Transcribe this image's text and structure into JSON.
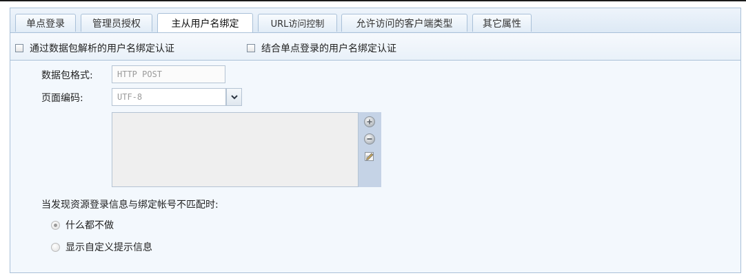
{
  "tabs": [
    {
      "label": "单点登录"
    },
    {
      "label": "管理员授权"
    },
    {
      "label": "主从用户名绑定"
    },
    {
      "label": "URL访问控制"
    },
    {
      "label": "允许访问的客户端类型"
    },
    {
      "label": "其它属性"
    }
  ],
  "active_tab": "主从用户名绑定",
  "options": {
    "packet_parse_binding": {
      "label": "通过数据包解析的用户名绑定认证",
      "checked": false
    },
    "sso_binding": {
      "label": "结合单点登录的用户名绑定认证",
      "checked": false
    }
  },
  "form": {
    "packet_format": {
      "label": "数据包格式:",
      "value": "HTTP POST"
    },
    "page_encoding": {
      "label": "页面编码:",
      "value": "UTF-8"
    },
    "mismatch_label": "当发现资源登录信息与绑定帐号不匹配时:",
    "mismatch_options": [
      {
        "label": "什么都不做",
        "selected": true
      },
      {
        "label": "显示自定义提示信息",
        "selected": false
      }
    ]
  },
  "icons": [
    "add-icon",
    "remove-icon",
    "edit-icon",
    "chevron-down-icon"
  ]
}
